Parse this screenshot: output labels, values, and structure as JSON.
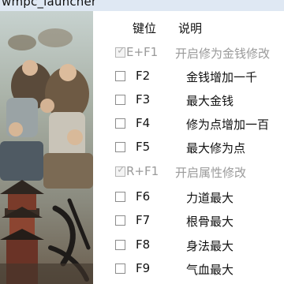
{
  "window": {
    "title": "wmpc_launcher"
  },
  "header": {
    "key_label": "键位",
    "desc_label": "说明"
  },
  "rows": [
    {
      "key": "E+F1",
      "desc": "开启修为金钱修改",
      "checked": true,
      "group": true
    },
    {
      "key": "F2",
      "desc": "金钱增加一千",
      "checked": false,
      "group": false
    },
    {
      "key": "F3",
      "desc": "最大金钱",
      "checked": false,
      "group": false
    },
    {
      "key": "F4",
      "desc": "修为点增加一百",
      "checked": false,
      "group": false
    },
    {
      "key": "F5",
      "desc": "最大修为点",
      "checked": false,
      "group": false
    },
    {
      "key": "R+F1",
      "desc": "开启属性修改",
      "checked": true,
      "group": true
    },
    {
      "key": "F6",
      "desc": "力道最大",
      "checked": false,
      "group": false
    },
    {
      "key": "F7",
      "desc": "根骨最大",
      "checked": false,
      "group": false
    },
    {
      "key": "F8",
      "desc": "身法最大",
      "checked": false,
      "group": false
    },
    {
      "key": "F9",
      "desc": "气血最大",
      "checked": false,
      "group": false
    }
  ],
  "colors": {
    "disabled_text": "#9a9a9a",
    "titlebar": "#dfe8f3"
  },
  "icons": {
    "check": "checkmark-icon"
  }
}
